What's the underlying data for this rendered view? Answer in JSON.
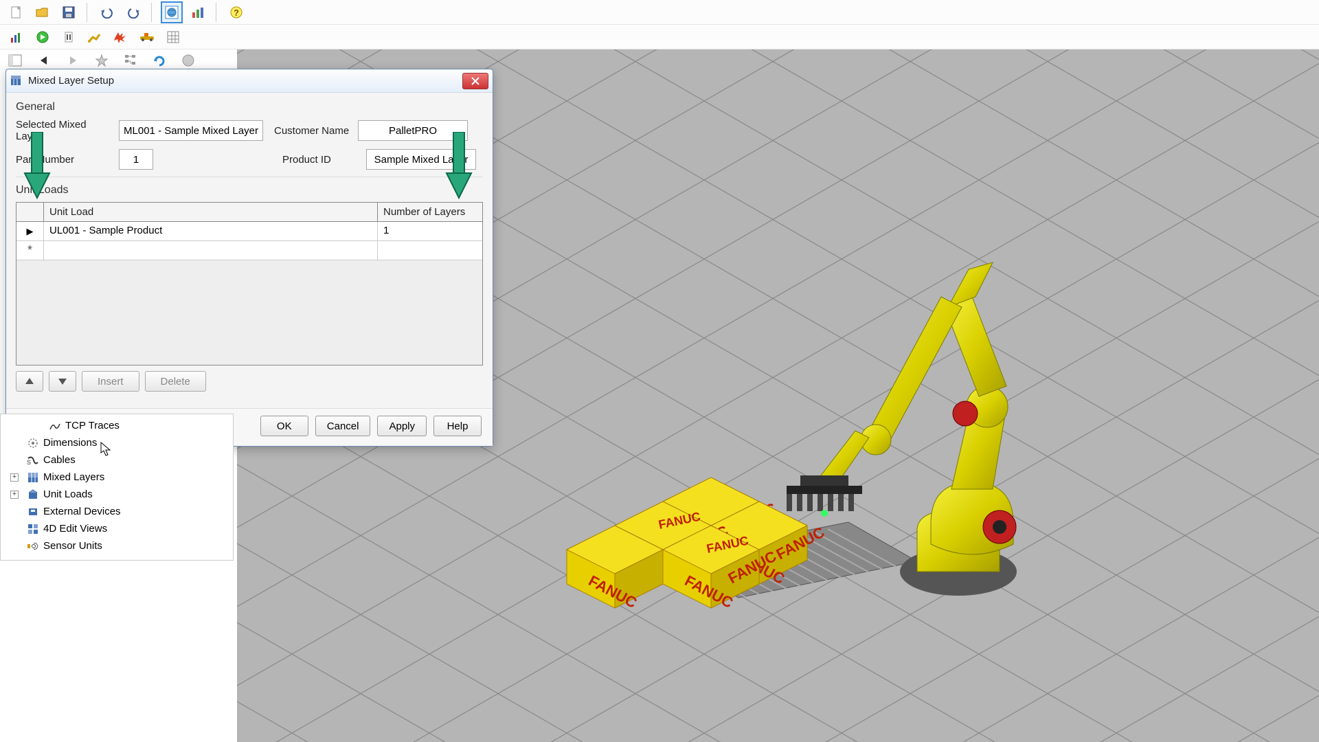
{
  "toolbar1": {
    "icons": [
      "new-file-icon",
      "open-folder-icon",
      "save-icon",
      "undo-icon",
      "redo-icon",
      "world-icon",
      "chart-icon",
      "help-icon"
    ]
  },
  "toolbar2": {
    "icons": [
      "stats-icon",
      "play-icon",
      "stop-icon",
      "robot-icon",
      "collision-icon",
      "convey-icon",
      "grid-icon"
    ]
  },
  "nav": {
    "icons": [
      "back-icon",
      "forward-icon",
      "star-icon",
      "tree-icon",
      "refresh-icon",
      "world-sm-icon"
    ]
  },
  "dialog": {
    "title": "Mixed Layer Setup",
    "section_general": "General",
    "selected_layer_label": "Selected Mixed Layer",
    "selected_layer_value": "ML001 - Sample Mixed Layer",
    "customer_label": "Customer Name",
    "customer_value": "PalletPRO",
    "part_number_label": "Part Number",
    "part_number_value": "1",
    "product_id_label": "Product ID",
    "product_id_value": "Sample Mixed Layer",
    "section_unitloads": "Unit Loads",
    "col_unit_load": "Unit Load",
    "col_num_layers": "Number of Layers",
    "rows": [
      {
        "unit_load": "UL001 - Sample Product",
        "layers": "1"
      }
    ],
    "btn_insert": "Insert",
    "btn_delete": "Delete",
    "btn_ok": "OK",
    "btn_cancel": "Cancel",
    "btn_apply": "Apply",
    "btn_help": "Help"
  },
  "tree": {
    "items": [
      {
        "label": "TCP Traces",
        "icon": "trace-icon",
        "indent": true
      },
      {
        "label": "Dimensions",
        "icon": "dim-icon"
      },
      {
        "label": "Cables",
        "icon": "cable-icon"
      },
      {
        "label": "Mixed Layers",
        "icon": "mixedlayer-icon",
        "expander": "+"
      },
      {
        "label": "Unit Loads",
        "icon": "unitload-icon",
        "expander": "+"
      },
      {
        "label": "External Devices",
        "icon": "extdev-icon"
      },
      {
        "label": "4D Edit Views",
        "icon": "4dview-icon"
      },
      {
        "label": "Sensor Units",
        "icon": "sensor-icon"
      }
    ]
  },
  "box_label": "FANUC"
}
